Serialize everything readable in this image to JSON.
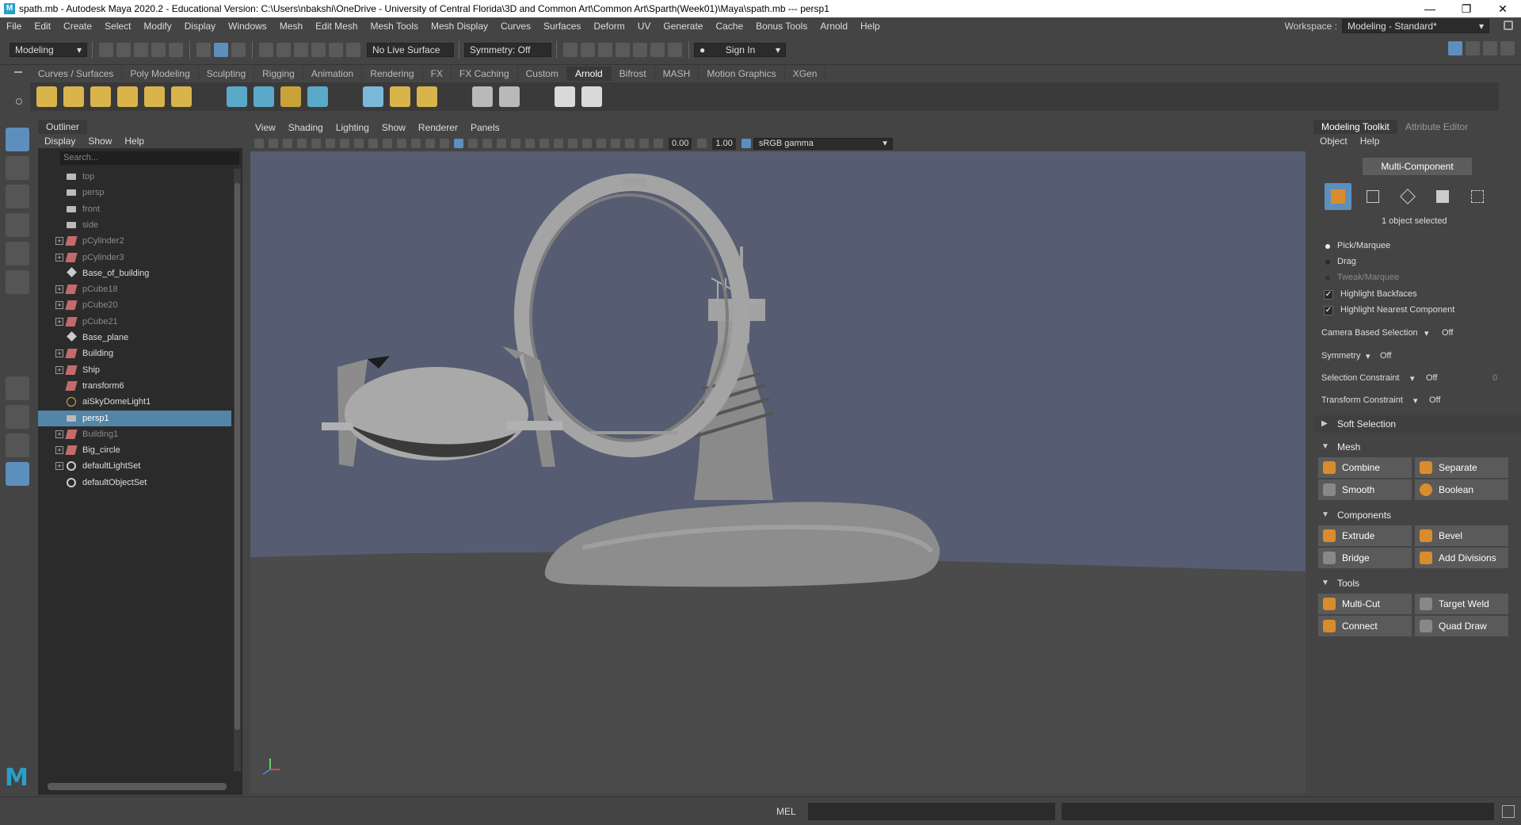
{
  "window": {
    "title": "spath.mb - Autodesk Maya 2020.2 - Educational Version: C:\\Users\\nbakshi\\OneDrive - University of Central Florida\\3D and Common Art\\Common Art\\Sparth(Week01)\\Maya\\spath.mb  ---  persp1",
    "logo": "M"
  },
  "menubar": {
    "items": [
      "File",
      "Edit",
      "Create",
      "Select",
      "Modify",
      "Display",
      "Windows",
      "Mesh",
      "Edit Mesh",
      "Mesh Tools",
      "Mesh Display",
      "Curves",
      "Surfaces",
      "Deform",
      "UV",
      "Generate",
      "Cache",
      "Bonus Tools",
      "Arnold",
      "Help"
    ],
    "workspace_label": "Workspace :",
    "workspace_value": "Modeling - Standard*"
  },
  "statusline": {
    "menuset": "Modeling",
    "live_surface": "No Live Surface",
    "symmetry": "Symmetry: Off",
    "sign_in": "Sign In"
  },
  "shelf": {
    "tabs": [
      "Curves / Surfaces",
      "Poly Modeling",
      "Sculpting",
      "Rigging",
      "Animation",
      "Rendering",
      "FX",
      "FX Caching",
      "Custom",
      "Arnold",
      "Bifrost",
      "MASH",
      "Motion Graphics",
      "XGen"
    ],
    "active_tab": "Arnold"
  },
  "outliner": {
    "tab": "Outliner",
    "menu": [
      "Display",
      "Show",
      "Help"
    ],
    "search_placeholder": "Search...",
    "items": [
      {
        "label": "top",
        "dim": true,
        "expand": false,
        "icon": "camera-icon"
      },
      {
        "label": "persp",
        "dim": true,
        "expand": false,
        "icon": "camera-icon"
      },
      {
        "label": "front",
        "dim": true,
        "expand": false,
        "icon": "camera-icon"
      },
      {
        "label": "side",
        "dim": true,
        "expand": false,
        "icon": "camera-icon"
      },
      {
        "label": "pCylinder2",
        "dim": true,
        "expand": true,
        "icon": "mesh-icon"
      },
      {
        "label": "pCylinder3",
        "dim": true,
        "expand": true,
        "icon": "mesh-icon"
      },
      {
        "label": "Base_of_building",
        "dim": false,
        "expand": false,
        "icon": "transform-icon"
      },
      {
        "label": "pCube18",
        "dim": true,
        "expand": true,
        "icon": "mesh-icon"
      },
      {
        "label": "pCube20",
        "dim": true,
        "expand": true,
        "icon": "mesh-icon"
      },
      {
        "label": "pCube21",
        "dim": true,
        "expand": true,
        "icon": "mesh-icon"
      },
      {
        "label": "Base_plane",
        "dim": false,
        "expand": false,
        "icon": "transform-icon"
      },
      {
        "label": "Building",
        "dim": false,
        "expand": true,
        "icon": "mesh-icon"
      },
      {
        "label": "Ship",
        "dim": false,
        "expand": true,
        "icon": "mesh-icon"
      },
      {
        "label": "transform6",
        "dim": false,
        "expand": false,
        "icon": "mesh-icon"
      },
      {
        "label": "aiSkyDomeLight1",
        "dim": false,
        "expand": false,
        "icon": "light-icon"
      },
      {
        "label": "persp1",
        "dim": false,
        "expand": false,
        "icon": "camera-icon",
        "selected": true
      },
      {
        "label": "Building1",
        "dim": true,
        "expand": true,
        "icon": "mesh-icon"
      },
      {
        "label": "Big_circle",
        "dim": false,
        "expand": true,
        "icon": "mesh-icon"
      },
      {
        "label": "defaultLightSet",
        "dim": false,
        "expand": true,
        "icon": "set-icon"
      },
      {
        "label": "defaultObjectSet",
        "dim": false,
        "expand": false,
        "icon": "set-icon"
      }
    ]
  },
  "viewport": {
    "menu": [
      "View",
      "Shading",
      "Lighting",
      "Show",
      "Renderer",
      "Panels"
    ],
    "exposure": "0.00",
    "gamma": "1.00",
    "color_space": "sRGB gamma",
    "colors": {
      "sky": "#565d72",
      "ground": "#4b4b4b",
      "model": "#9a9a9a"
    }
  },
  "modeling_toolkit": {
    "tabs": [
      "Modeling Toolkit",
      "Attribute Editor"
    ],
    "menu": [
      "Object",
      "Help"
    ],
    "multi_component": "Multi-Component",
    "selection_info": "1 object selected",
    "pick_marquee": "Pick/Marquee",
    "drag": "Drag",
    "tweak_marquee": "Tweak/Marquee",
    "highlight_backfaces": "Highlight Backfaces",
    "highlight_nearest": "Highlight Nearest Component",
    "camera_based_selection": {
      "label": "Camera Based Selection",
      "value": "Off"
    },
    "symmetry": {
      "label": "Symmetry",
      "value": "Off"
    },
    "selection_constraint": {
      "label": "Selection Constraint",
      "value": "Off",
      "num": "0"
    },
    "transform_constraint": {
      "label": "Transform Constraint",
      "value": "Off"
    },
    "soft_selection": "Soft Selection",
    "sections": {
      "mesh": {
        "title": "Mesh",
        "buttons": [
          "Combine",
          "Separate",
          "Smooth",
          "Boolean"
        ]
      },
      "components": {
        "title": "Components",
        "buttons": [
          "Extrude",
          "Bevel",
          "Bridge",
          "Add Divisions"
        ]
      },
      "tools": {
        "title": "Tools",
        "buttons": [
          "Multi-Cut",
          "Target Weld",
          "Connect",
          "Quad Draw"
        ]
      }
    }
  },
  "commandline": {
    "label": "MEL"
  }
}
